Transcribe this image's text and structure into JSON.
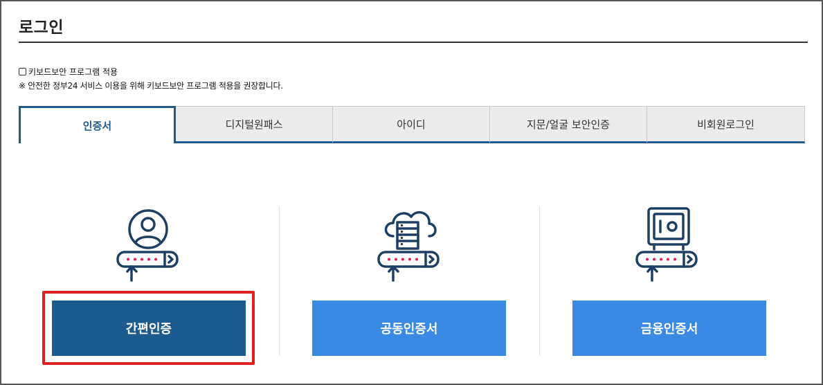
{
  "page": {
    "title": "로그인"
  },
  "keyboard_security": {
    "checkbox_label": "키보드보안 프로그램 적용",
    "checked": false,
    "notice": "※ 안전한 정부24 서비스 이용을 위해 키보드보안 프로그램 적용을 권장합니다."
  },
  "tabs": [
    {
      "label": "인증서",
      "active": true
    },
    {
      "label": "디지털원패스",
      "active": false
    },
    {
      "label": "아이디",
      "active": false
    },
    {
      "label": "지문/얼굴 보안인증",
      "active": false
    },
    {
      "label": "비회원로그인",
      "active": false
    }
  ],
  "methods": [
    {
      "label": "간편인증",
      "icon": "user-password-icon",
      "highlighted": true
    },
    {
      "label": "공동인증서",
      "icon": "cloud-server-password-icon",
      "highlighted": false
    },
    {
      "label": "금융인증서",
      "icon": "safe-password-icon",
      "highlighted": false
    }
  ],
  "colors": {
    "primary": "#1d5a8e",
    "secondary": "#3a89e3",
    "highlight": "#e02020",
    "password_dots": "#e0204a"
  }
}
